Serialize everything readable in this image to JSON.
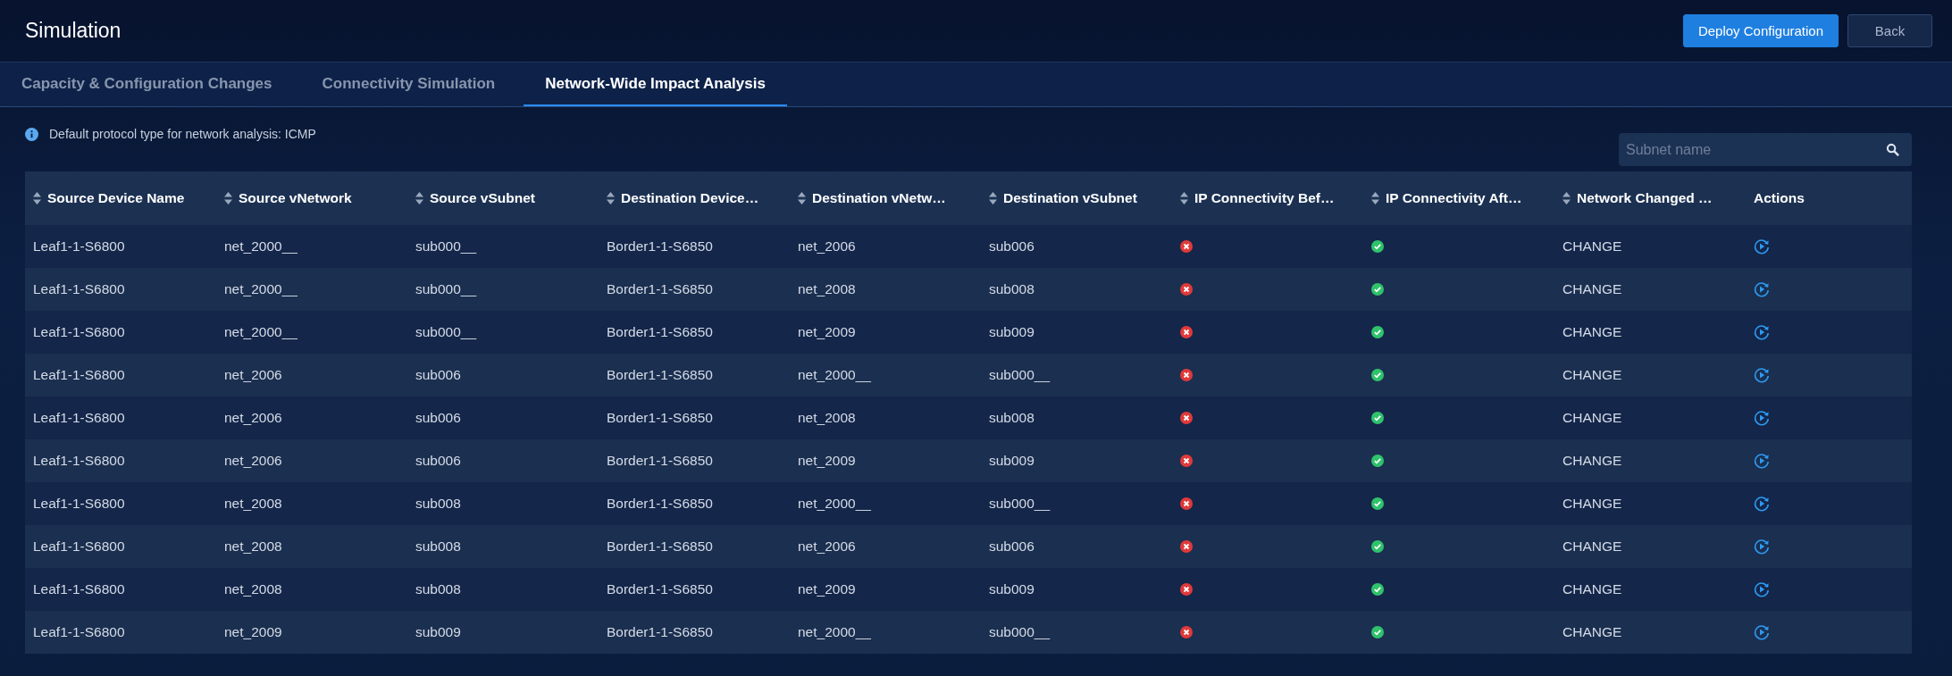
{
  "header": {
    "title": "Simulation",
    "buttons": [
      {
        "label": "Deploy Configuration",
        "primary": true
      },
      {
        "label": "Back",
        "primary": false
      }
    ]
  },
  "tabs": [
    {
      "label": "Capacity & Configuration Changes",
      "selected": false
    },
    {
      "label": "Connectivity Simulation",
      "selected": false
    },
    {
      "label": "Network-Wide Impact Analysis",
      "selected": true
    }
  ],
  "info": "Default protocol type for network analysis: ICMP",
  "search": {
    "placeholder": "Subnet name"
  },
  "table": {
    "columns": [
      {
        "label": "Source Device Name",
        "sortable": true
      },
      {
        "label": "Source vNetwork",
        "sortable": true
      },
      {
        "label": "Source vSubnet",
        "sortable": true
      },
      {
        "label": "Destination Device…",
        "sortable": true
      },
      {
        "label": "Destination vNetw…",
        "sortable": true
      },
      {
        "label": "Destination vSubnet",
        "sortable": true
      },
      {
        "label": "IP Connectivity Bef…",
        "sortable": true
      },
      {
        "label": "IP Connectivity Aft…",
        "sortable": true
      },
      {
        "label": "Network Changed …",
        "sortable": true
      },
      {
        "label": "Actions",
        "sortable": false
      }
    ],
    "rows": [
      {
        "cells": [
          "Leaf1-1-S6800",
          "net_2000__",
          "sub000__",
          "Border1-1-S6850",
          "net_2006",
          "sub006"
        ],
        "before_ok": false,
        "after_ok": true,
        "change": "CHANGE"
      },
      {
        "cells": [
          "Leaf1-1-S6800",
          "net_2000__",
          "sub000__",
          "Border1-1-S6850",
          "net_2008",
          "sub008"
        ],
        "before_ok": false,
        "after_ok": true,
        "change": "CHANGE"
      },
      {
        "cells": [
          "Leaf1-1-S6800",
          "net_2000__",
          "sub000__",
          "Border1-1-S6850",
          "net_2009",
          "sub009"
        ],
        "before_ok": false,
        "after_ok": true,
        "change": "CHANGE"
      },
      {
        "cells": [
          "Leaf1-1-S6800",
          "net_2006",
          "sub006",
          "Border1-1-S6850",
          "net_2000__",
          "sub000__"
        ],
        "before_ok": false,
        "after_ok": true,
        "change": "CHANGE"
      },
      {
        "cells": [
          "Leaf1-1-S6800",
          "net_2006",
          "sub006",
          "Border1-1-S6850",
          "net_2008",
          "sub008"
        ],
        "before_ok": false,
        "after_ok": true,
        "change": "CHANGE"
      },
      {
        "cells": [
          "Leaf1-1-S6800",
          "net_2006",
          "sub006",
          "Border1-1-S6850",
          "net_2009",
          "sub009"
        ],
        "before_ok": false,
        "after_ok": true,
        "change": "CHANGE"
      },
      {
        "cells": [
          "Leaf1-1-S6800",
          "net_2008",
          "sub008",
          "Border1-1-S6850",
          "net_2000__",
          "sub000__"
        ],
        "before_ok": false,
        "after_ok": true,
        "change": "CHANGE"
      },
      {
        "cells": [
          "Leaf1-1-S6800",
          "net_2008",
          "sub008",
          "Border1-1-S6850",
          "net_2006",
          "sub006"
        ],
        "before_ok": false,
        "after_ok": true,
        "change": "CHANGE"
      },
      {
        "cells": [
          "Leaf1-1-S6800",
          "net_2008",
          "sub008",
          "Border1-1-S6850",
          "net_2009",
          "sub009"
        ],
        "before_ok": false,
        "after_ok": true,
        "change": "CHANGE"
      },
      {
        "cells": [
          "Leaf1-1-S6800",
          "net_2009",
          "sub009",
          "Border1-1-S6850",
          "net_2000__",
          "sub000__"
        ],
        "before_ok": false,
        "after_ok": true,
        "change": "CHANGE"
      }
    ]
  }
}
